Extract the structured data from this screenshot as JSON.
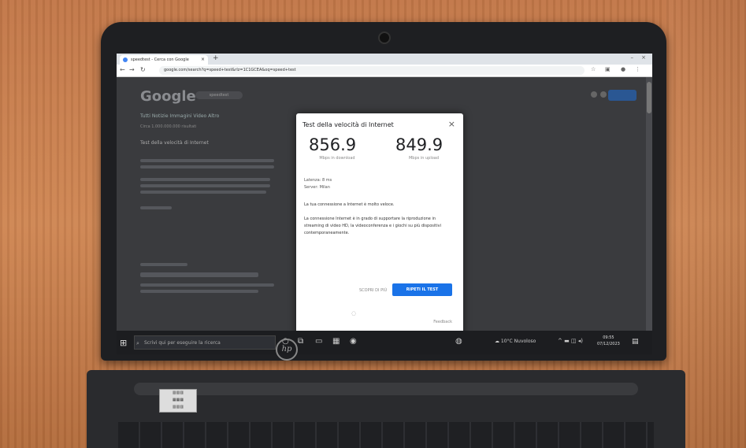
{
  "browser": {
    "tab_title": "speedtest - Cerca con Google",
    "new_tab": "+",
    "url": "google.com/search?q=speed+test&rlz=1C1GCEA&oq=speed+test",
    "win_min": "–",
    "win_close": "×"
  },
  "google": {
    "logo": "Google",
    "search_text": "speedtest",
    "tabs": "Tutti   Notizie   Immagini   Video   Altro",
    "result_count": "Circa 1.000.000.000 risultati",
    "result_heading": "Test della velocità di Internet"
  },
  "speedtest": {
    "title": "Test della velocità di Internet",
    "close": "×",
    "download": "856.9",
    "download_label": "Mbps in download",
    "upload": "849.9",
    "upload_label": "Mbps in upload",
    "latency": "Latenza: 8 ms",
    "server": "Server: Milan",
    "speed_msg": "La tua connessione a Internet è molto veloce.",
    "detail_msg": "La connessione Internet è in grado di supportare la riproduzione in streaming di video HD, la videoconferenza e i giochi su più dispositivi contemporaneamente.",
    "more_button": "SCOPRI DI PIÙ",
    "retry_button": "RIPETI IL TEST",
    "feedback": "Feedback"
  },
  "taskbar": {
    "search_placeholder": "Scrivi qui per eseguire la ricerca",
    "weather": "10°C Nuvoloso",
    "time": "09:55",
    "date": "07/12/2023"
  },
  "laptop": {
    "brand": "hp"
  }
}
